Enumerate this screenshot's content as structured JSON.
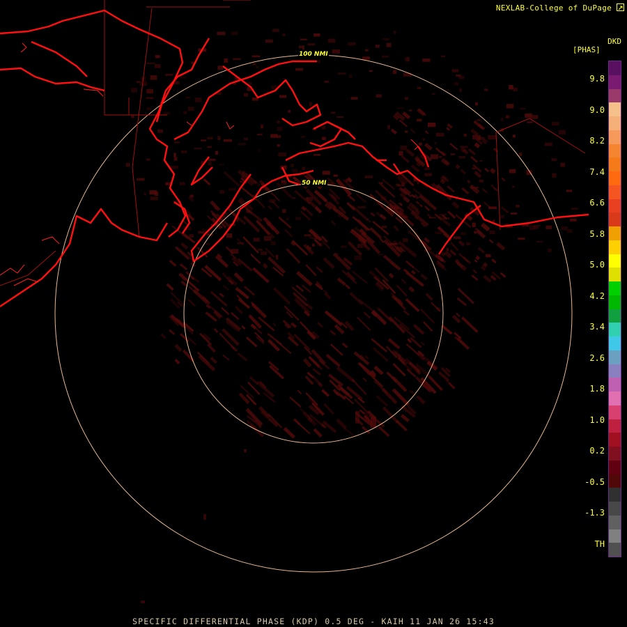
{
  "credit": "NEXLAB-College of DuPage",
  "credit_icon": "external-link-icon",
  "legend": {
    "product_code": "DKD",
    "unit": "[PHAS]",
    "labels": [
      "9.8",
      "9.0",
      "8.2",
      "7.4",
      "6.6",
      "5.8",
      "5.0",
      "4.2",
      "3.4",
      "2.6",
      "1.8",
      "1.0",
      "0.2",
      "-0.5",
      "-1.3",
      "TH"
    ],
    "colors": [
      "#5a1060",
      "#7a1a70",
      "#9a3a6a",
      "#f5c08a",
      "#f5b07a",
      "#f59a5a",
      "#f58530",
      "#f57a1a",
      "#ff6a10",
      "#f55520",
      "#e84020",
      "#d83a1a",
      "#f0a000",
      "#ffd000",
      "#ffff00",
      "#e0e000",
      "#00d000",
      "#00b800",
      "#10a040",
      "#30d0b0",
      "#40c8e8",
      "#6aa0c0",
      "#8a80c0",
      "#c060b0",
      "#e070b0",
      "#d84070",
      "#c02040",
      "#a01020",
      "#801020",
      "#600010",
      "#500808",
      "#303030",
      "#484848",
      "#606060",
      "#808080",
      "#505050"
    ]
  },
  "rings": [
    {
      "label": "100 NMI"
    },
    {
      "label": "50 NMI"
    }
  ],
  "footer": "SPECIFIC DIFFERENTIAL PHASE (KDP) 0.5 DEG - KAIH 11 JAN 26 15:43"
}
